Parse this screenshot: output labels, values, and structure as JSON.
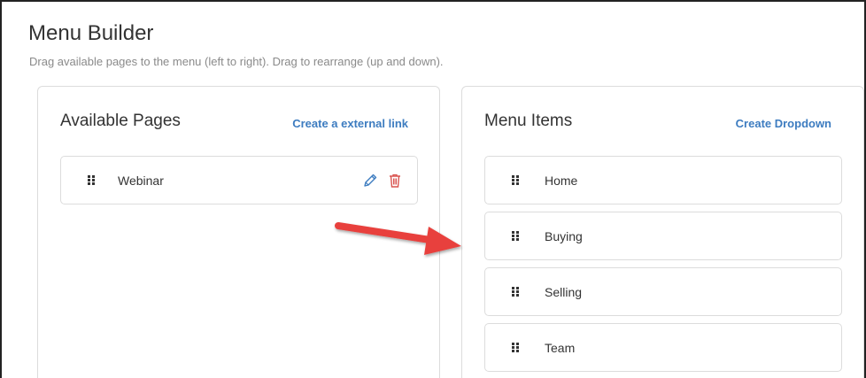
{
  "header": {
    "title": "Menu Builder",
    "subtitle": "Drag available pages to the menu (left to right). Drag to rearrange (up and down)."
  },
  "available_pages": {
    "title": "Available Pages",
    "action_label": "Create a external link",
    "items": [
      {
        "label": "Webinar"
      }
    ]
  },
  "menu_items": {
    "title": "Menu Items",
    "action_label": "Create Dropdown",
    "items": [
      {
        "label": "Home"
      },
      {
        "label": "Buying"
      },
      {
        "label": "Selling"
      },
      {
        "label": "Team"
      }
    ]
  },
  "colors": {
    "link": "#3d7cc0",
    "edit_icon": "#3d7cc0",
    "delete_icon": "#d9534f",
    "arrow": "#e8413c"
  },
  "icons": {
    "grip": "drag-handle-icon",
    "edit": "pencil-icon",
    "delete": "trash-icon",
    "annotation": "arrow-icon"
  }
}
